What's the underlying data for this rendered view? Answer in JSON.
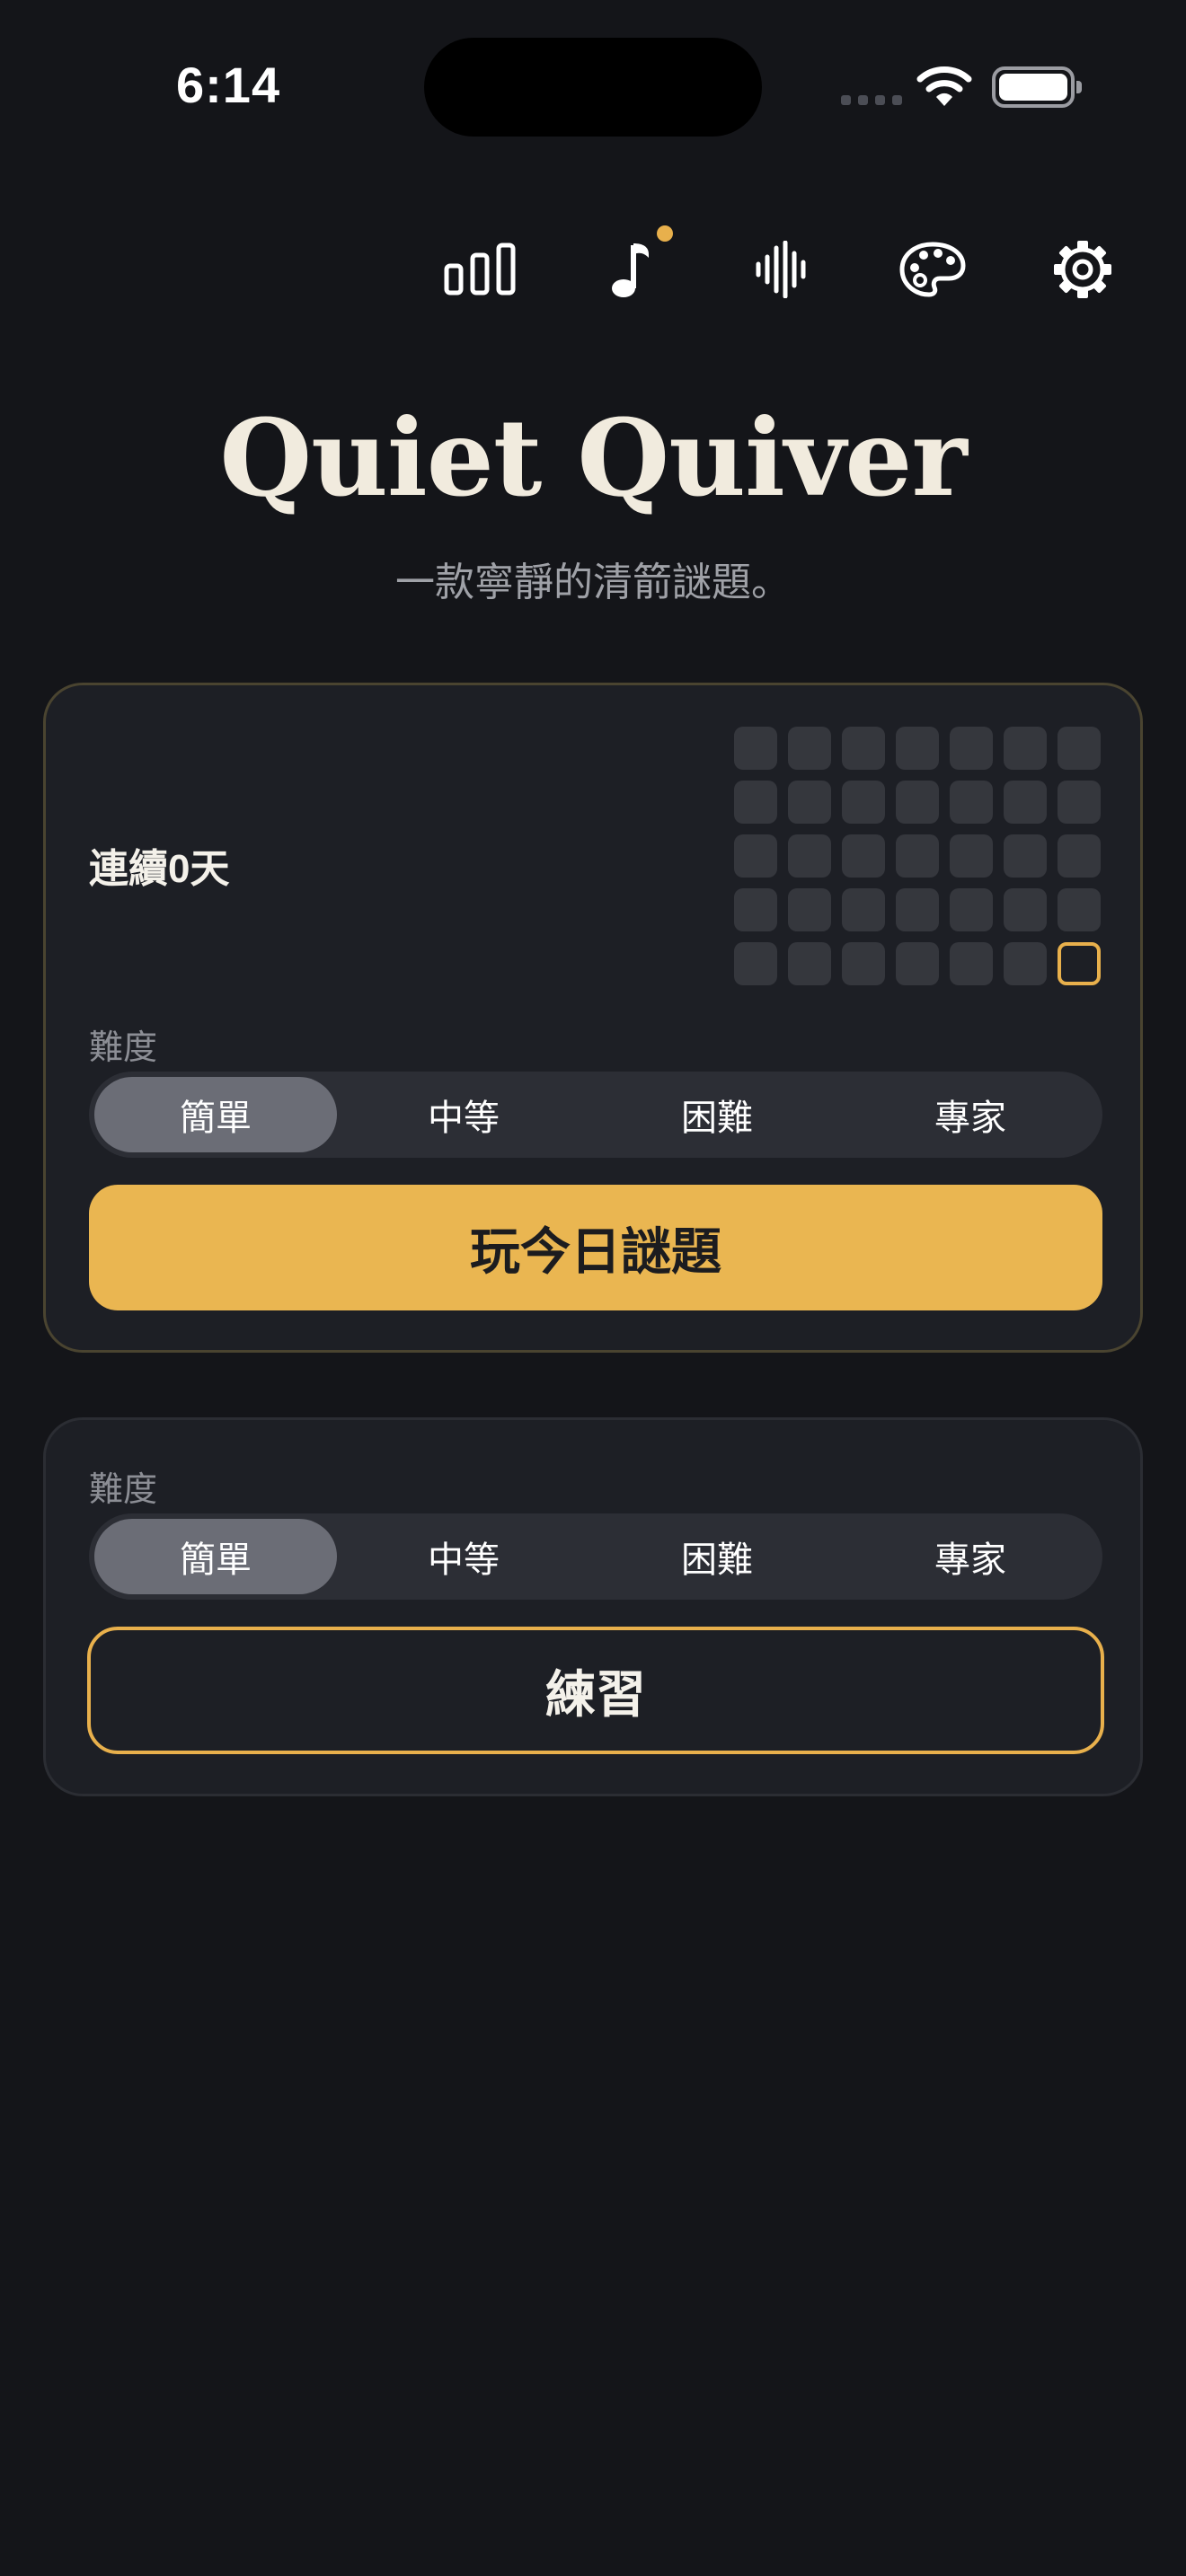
{
  "status_bar": {
    "time": "6:14",
    "icons": [
      "cellular-signal-icon",
      "wifi-icon",
      "battery-icon"
    ]
  },
  "toolbar": {
    "icons": [
      "stats-icon",
      "music-icon",
      "sound-waveform-icon",
      "palette-icon",
      "gear-icon"
    ],
    "accent_color": "#e8b04c"
  },
  "header": {
    "title": "Quiet Quiver",
    "subtitle": "一款寧靜的清箭謎題。"
  },
  "daily_card": {
    "streak_text": "連續0天",
    "difficulty_label": "難度",
    "difficulty_options": [
      "簡單",
      "中等",
      "困難",
      "專家"
    ],
    "selected_difficulty": "簡單",
    "play_button_label": "玩今日謎題"
  },
  "practice_card": {
    "difficulty_label": "難度",
    "difficulty_options": [
      "簡單",
      "中等",
      "困難",
      "專家"
    ],
    "selected_difficulty": "簡單",
    "practice_button_label": "練習"
  },
  "colors": {
    "background": "#141519",
    "card": "#1d1f25",
    "accent": "#eab651",
    "title": "#f1ebde"
  }
}
